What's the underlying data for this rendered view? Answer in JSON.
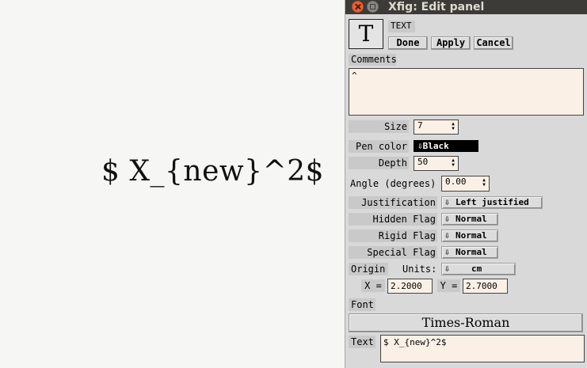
{
  "canvas": {
    "text": "$ X_{new}^2$"
  },
  "window": {
    "title": "Xfig: Edit panel"
  },
  "header": {
    "icon_letter": "T",
    "object_type": "TEXT"
  },
  "buttons": {
    "done": "Done",
    "apply": "Apply",
    "cancel": "Cancel"
  },
  "comments": {
    "label": "Comments",
    "value": "^"
  },
  "size": {
    "label": "Size",
    "value": "7"
  },
  "pen_color": {
    "label": "Pen color",
    "value": "Black"
  },
  "depth": {
    "label": "Depth",
    "value": "50"
  },
  "angle": {
    "label": "Angle (degrees)",
    "value": "0.00"
  },
  "justification": {
    "label": "Justification",
    "value": "Left justified"
  },
  "hidden_flag": {
    "label": "Hidden Flag",
    "value": "Normal"
  },
  "rigid_flag": {
    "label": "Rigid Flag",
    "value": "Normal"
  },
  "special_flag": {
    "label": "Special Flag",
    "value": "Normal"
  },
  "origin": {
    "label": "Origin",
    "units_label": "Units:",
    "units_value": "cm",
    "x_label": "X =",
    "x_value": "2.2000",
    "y_label": "Y =",
    "y_value": "2.7000"
  },
  "font": {
    "label": "Font",
    "value": "Times-Roman"
  },
  "text": {
    "label": "Text",
    "value": "$ X_{new}^2$"
  }
}
